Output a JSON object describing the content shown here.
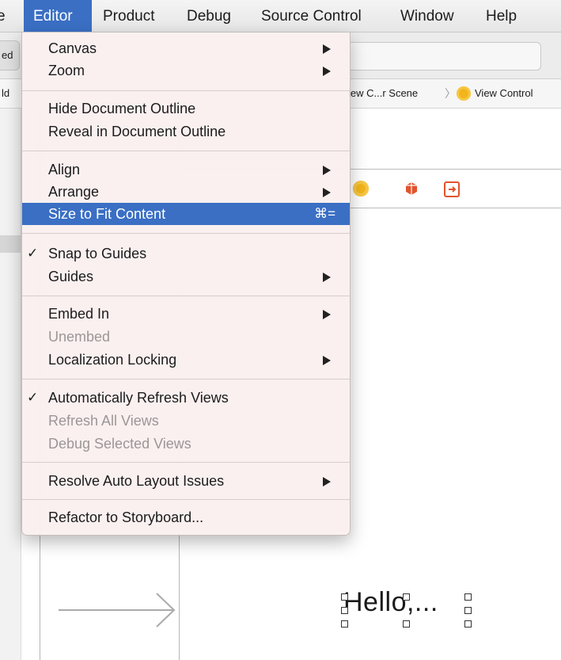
{
  "menubar": {
    "items": [
      {
        "label": "e"
      },
      {
        "label": "Editor"
      },
      {
        "label": "Product"
      },
      {
        "label": "Debug"
      },
      {
        "label": "Source Control"
      },
      {
        "label": "Window"
      },
      {
        "label": "Help"
      }
    ]
  },
  "window": {
    "scheme_fragment": "ed",
    "jump_bar": {
      "left_fragment": "ld",
      "crumb_scene": "iew C...r Scene",
      "separator": "〉",
      "crumb_controller": "View Control"
    },
    "canvas": {
      "label_text": "Hello,..."
    }
  },
  "editor_menu": {
    "items": [
      {
        "label": "Canvas",
        "submenu": true
      },
      {
        "label": "Zoom",
        "submenu": true
      },
      {
        "label": "Hide Document Outline"
      },
      {
        "label": "Reveal in Document Outline"
      },
      {
        "label": "Align",
        "submenu": true
      },
      {
        "label": "Arrange",
        "submenu": true
      },
      {
        "label": "Size to Fit Content",
        "shortcut": "⌘="
      },
      {
        "label": "Snap to Guides",
        "check": "✓"
      },
      {
        "label": "Guides",
        "submenu": true
      },
      {
        "label": "Embed In",
        "submenu": true
      },
      {
        "label": "Unembed"
      },
      {
        "label": "Localization Locking",
        "submenu": true
      },
      {
        "label": "Automatically Refresh Views",
        "check": "✓"
      },
      {
        "label": "Refresh All Views"
      },
      {
        "label": "Debug Selected Views"
      },
      {
        "label": "Resolve Auto Layout Issues",
        "submenu": true
      },
      {
        "label": "Refactor to Storyboard..."
      }
    ]
  },
  "colors": {
    "menu_highlight": "#3a6fc4",
    "menu_background": "#faf0f0",
    "disabled_text": "#9c9696",
    "view_controller_icon": "#f2b51c",
    "exit_icon": "#e2542d"
  }
}
